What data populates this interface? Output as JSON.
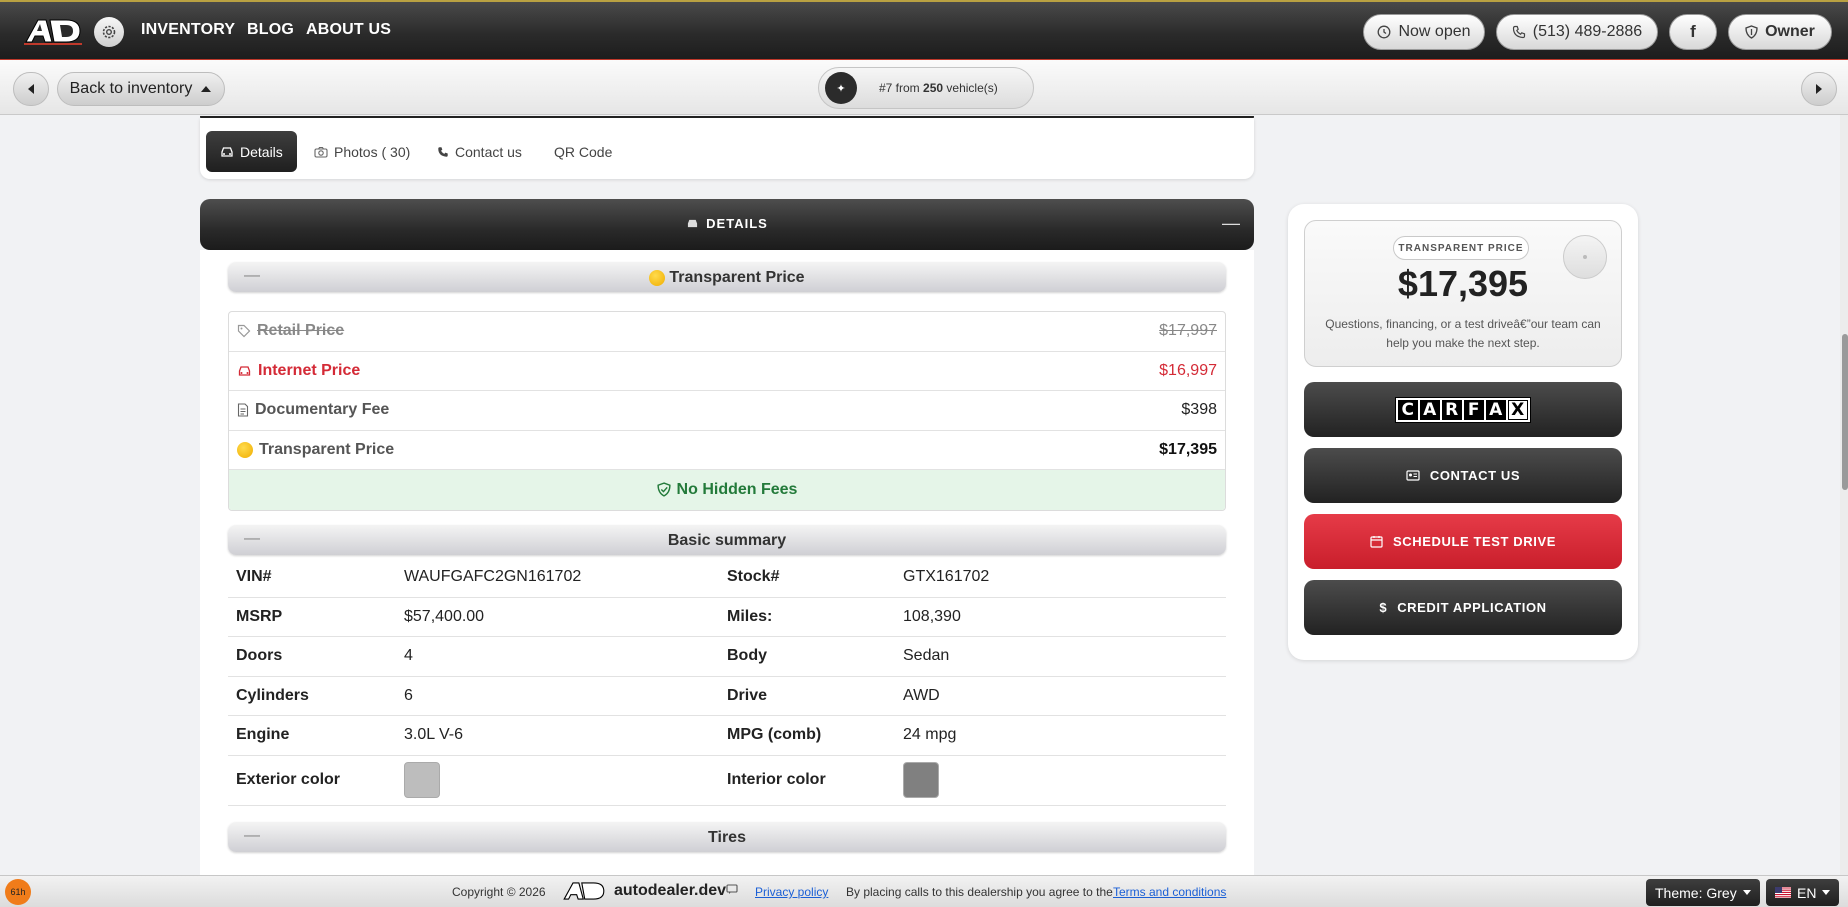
{
  "topnav": {
    "links": [
      "INVENTORY",
      "BLOG",
      "ABOUT US"
    ],
    "now_open": "Now open",
    "phone": "(513) 489-2886",
    "facebook": "f",
    "owner": "Owner"
  },
  "subbar": {
    "back_label": "Back to inventory",
    "counter_prefix": "#7 from",
    "counter_total": "250",
    "counter_suffix": "vehicle(s)"
  },
  "tabs": [
    {
      "label": "Details"
    },
    {
      "label": "Photos ( 30)"
    },
    {
      "label": "Contact us"
    },
    {
      "label": "QR Code"
    }
  ],
  "details": {
    "header": "DETAILS",
    "collapse": "—"
  },
  "transparent_section": {
    "title": "Transparent Price",
    "rows": [
      {
        "label": "Retail Price",
        "value": "$17,997"
      },
      {
        "label": "Internet Price",
        "value": "$16,997"
      },
      {
        "label": "Documentary Fee",
        "value": "$398"
      },
      {
        "label": "Transparent Price",
        "value": "$17,395"
      }
    ],
    "no_hidden_fees": "No Hidden Fees"
  },
  "basic_summary": {
    "title": "Basic summary",
    "rows": [
      {
        "l1": "VIN#",
        "v1": "WAUFGAFC2GN161702",
        "l2": "Stock#",
        "v2": "GTX161702"
      },
      {
        "l1": "MSRP",
        "v1": "$57,400.00",
        "l2": "Miles:",
        "v2": "108,390"
      },
      {
        "l1": "Doors",
        "v1": "4",
        "l2": "Body",
        "v2": "Sedan"
      },
      {
        "l1": "Cylinders",
        "v1": "6",
        "l2": "Drive",
        "v2": "AWD"
      },
      {
        "l1": "Engine",
        "v1": "3.0L V-6",
        "l2": "MPG (comb)",
        "v2": "24 mpg"
      }
    ],
    "exterior_label": "Exterior color",
    "interior_label": "Interior color",
    "exterior_color": "#bdbdbd",
    "interior_color": "#808080"
  },
  "tires_section": {
    "title": "Tires"
  },
  "sidebar": {
    "badge": "TRANSPARENT PRICE",
    "price": "$17,395",
    "desc": "Questions, financing, or a test driveâ€”our team can help you make the next step.",
    "carfax_letters": [
      "C",
      "A",
      "R",
      "F",
      "A",
      "X"
    ],
    "contact": "CONTACT US",
    "test_drive": "SCHEDULE TEST DRIVE",
    "credit": "CREDIT APPLICATION",
    "credit_icon": "$"
  },
  "footer": {
    "badge": "61h",
    "copyright": "Copyright © 2026",
    "brand": "autodealer.dev",
    "privacy": "Privacy policy",
    "agree_text": "By placing calls to this dealership you agree to the",
    "terms": "Terms and conditions",
    "theme": "Theme: Grey",
    "lang": "EN"
  },
  "colors": {
    "accent_red": "#d42a36",
    "nav_dark": "#2b2b2b",
    "success_green": "#237a3a"
  }
}
